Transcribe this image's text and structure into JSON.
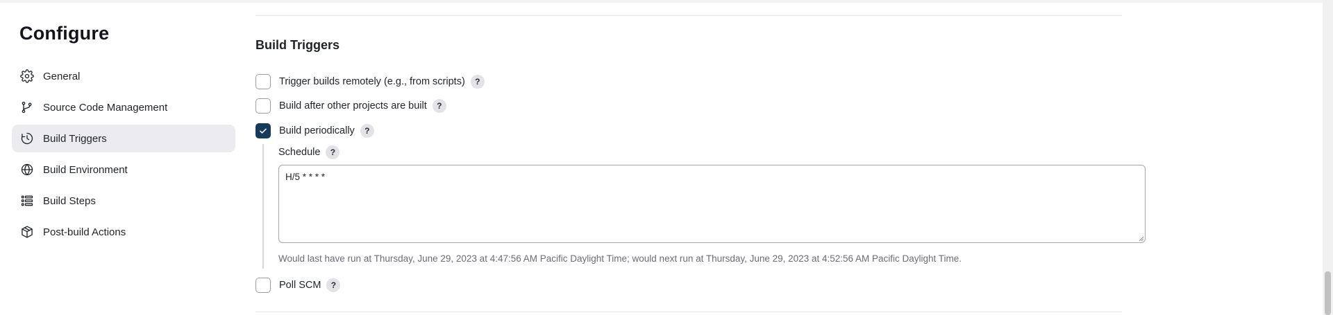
{
  "page": {
    "title": "Configure"
  },
  "sidebar": {
    "items": [
      {
        "label": "General",
        "icon": "gear-icon"
      },
      {
        "label": "Source Code Management",
        "icon": "git-branch-icon"
      },
      {
        "label": "Build Triggers",
        "icon": "clock-icon",
        "active": true
      },
      {
        "label": "Build Environment",
        "icon": "globe-icon"
      },
      {
        "label": "Build Steps",
        "icon": "list-icon"
      },
      {
        "label": "Post-build Actions",
        "icon": "package-icon"
      }
    ]
  },
  "section": {
    "title": "Build Triggers",
    "help_glyph": "?",
    "triggers": [
      {
        "label": "Trigger builds remotely (e.g., from scripts)",
        "checked": false
      },
      {
        "label": "Build after other projects are built",
        "checked": false
      },
      {
        "label": "Build periodically",
        "checked": true
      },
      {
        "label": "Poll SCM",
        "checked": false
      }
    ],
    "schedule": {
      "label": "Schedule",
      "value": "H/5 * * * *",
      "note": "Would last have run at Thursday, June 29, 2023 at 4:47:56 AM Pacific Daylight Time; would next run at Thursday, June 29, 2023 at 4:52:56 AM Pacific Daylight Time."
    }
  },
  "colors": {
    "accent": "#163b5a",
    "active_bg": "#ebebf0",
    "muted_text": "#6b6b75"
  }
}
